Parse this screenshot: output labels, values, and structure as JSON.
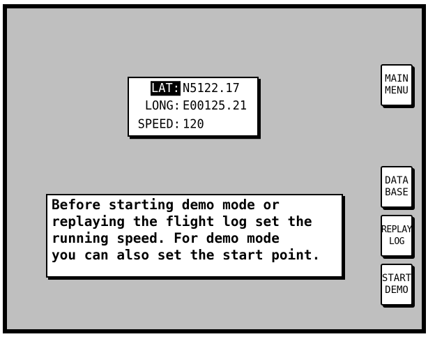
{
  "readout": {
    "lat_label": "LAT:",
    "lat_value": "N5122.17",
    "long_label": "LONG:",
    "long_value": "E00125.21",
    "speed_label": "SPEED:",
    "speed_value": "120"
  },
  "info": {
    "lines": [
      "Before starting demo mode or",
      "replaying the flight log set the",
      "running speed. For demo mode",
      "you can also set the start point."
    ]
  },
  "buttons": {
    "main_menu": [
      "MAIN",
      "MENU"
    ],
    "data_base": [
      "DATA",
      "BASE"
    ],
    "replay_log": [
      "REPLAY",
      "LOG"
    ],
    "start_demo": [
      "START",
      "DEMO"
    ]
  },
  "colors": {
    "background": "#bfbfbf",
    "frame": "#000000",
    "panel": "#ffffff"
  }
}
